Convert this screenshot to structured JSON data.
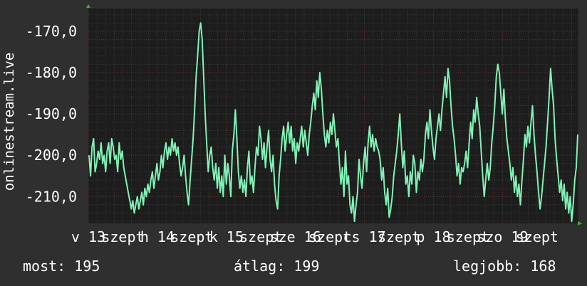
{
  "chart_data": {
    "type": "line",
    "ylabel": "onlinestream.live",
    "ylim": [
      -216.5,
      -164.5
    ],
    "y_ticks": [
      "-170,0",
      "-180,0",
      "-190,0",
      "-200,0",
      "-210,0"
    ],
    "y_tick_values": [
      -170,
      -180,
      -190,
      -200,
      -210
    ],
    "x_ticks": [
      "v 13",
      "szept",
      "h 14",
      "szept",
      "k 15",
      "szept",
      "sze 16",
      "szept",
      "cs 17",
      "szept",
      "p 18",
      "szept",
      "szo 19",
      "szept"
    ],
    "x_tick_positions": [
      0,
      0.5,
      1,
      1.5,
      2,
      2.5,
      3,
      3.5,
      4,
      4.5,
      5,
      5.5,
      6,
      6.5
    ],
    "xlim": [
      0,
      7.1
    ],
    "series": [
      {
        "color": "#7ff3b5",
        "values": [
          -200,
          -205,
          -198,
          -196,
          -204,
          -202,
          -199,
          -201,
          -197,
          -202,
          -200,
          -204,
          -199,
          -197,
          -202,
          -196,
          -198,
          -201,
          -200,
          -204,
          -197,
          -201,
          -199,
          -203,
          -205,
          -207,
          -209,
          -211,
          -213,
          -211,
          -214,
          -212,
          -210,
          -213,
          -211,
          -209,
          -212,
          -208,
          -210,
          -207,
          -209,
          -206,
          -204,
          -208,
          -205,
          -202,
          -206,
          -204,
          -200,
          -203,
          -199,
          -197,
          -201,
          -198,
          -200,
          -196,
          -199,
          -197,
          -200,
          -198,
          -202,
          -205,
          -203,
          -200,
          -205,
          -209,
          -212,
          -206,
          -201,
          -196,
          -189,
          -181,
          -176,
          -170,
          -168,
          -172,
          -181,
          -190,
          -197,
          -204,
          -200,
          -198,
          -203,
          -206,
          -202,
          -208,
          -203,
          -209,
          -205,
          -210,
          -200,
          -207,
          -202,
          -205,
          -210,
          -199,
          -195,
          -189,
          -196,
          -204,
          -208,
          -205,
          -209,
          -206,
          -210,
          -203,
          -199,
          -207,
          -205,
          -209,
          -203,
          -198,
          -200,
          -193,
          -196,
          -201,
          -197,
          -203,
          -198,
          -194,
          -201,
          -204,
          -200,
          -207,
          -211,
          -213,
          -205,
          -201,
          -196,
          -193,
          -199,
          -195,
          -192,
          -197,
          -193,
          -199,
          -196,
          -202,
          -197,
          -199,
          -196,
          -193,
          -198,
          -194,
          -197,
          -200,
          -195,
          -192,
          -188,
          -185,
          -189,
          -182,
          -186,
          -180,
          -184,
          -190,
          -195,
          -198,
          -194,
          -197,
          -192,
          -195,
          -190,
          -194,
          -198,
          -196,
          -202,
          -207,
          -203,
          -210,
          -199,
          -207,
          -205,
          -212,
          -214,
          -210,
          -216,
          -212,
          -209,
          -201,
          -205,
          -208,
          -202,
          -198,
          -204,
          -197,
          -193,
          -198,
          -195,
          -199,
          -196,
          -198,
          -199,
          -201,
          -206,
          -203,
          -209,
          -212,
          -208,
          -215,
          -213,
          -210,
          -205,
          -202,
          -199,
          -195,
          -190,
          -197,
          -203,
          -199,
          -207,
          -205,
          -210,
          -204,
          -207,
          -200,
          -202,
          -209,
          -204,
          -206,
          -201,
          -204,
          -201,
          -195,
          -192,
          -196,
          -189,
          -194,
          -198,
          -201,
          -196,
          -193,
          -190,
          -194,
          -189,
          -185,
          -181,
          -186,
          -179,
          -182,
          -188,
          -193,
          -196,
          -200,
          -205,
          -202,
          -207,
          -203,
          -204,
          -202,
          -199,
          -203,
          -197,
          -192,
          -196,
          -189,
          -192,
          -186,
          -190,
          -193,
          -199,
          -205,
          -210,
          -206,
          -202,
          -206,
          -203,
          -197,
          -193,
          -188,
          -181,
          -178,
          -180,
          -185,
          -190,
          -184,
          -191,
          -196,
          -199,
          -202,
          -206,
          -203,
          -209,
          -205,
          -210,
          -207,
          -212,
          -206,
          -201,
          -195,
          -198,
          -193,
          -197,
          -192,
          -188,
          -195,
          -200,
          -204,
          -209,
          -213,
          -210,
          -206,
          -202,
          -198,
          -192,
          -186,
          -179,
          -184,
          -188,
          -196,
          -201,
          -205,
          -209,
          -206,
          -211,
          -207,
          -213,
          -209,
          -214,
          -210,
          -216,
          -212,
          -206,
          -203,
          -195
        ]
      }
    ]
  },
  "stats": {
    "most": "most: 195",
    "atlag": "átlag: 199",
    "legjobb": "legjobb: 168"
  },
  "colors": {
    "background": "#2f2f2f",
    "plot_area": "#1d1d1d",
    "line": "#7ff3b5",
    "grid_minor": "#3a3a3a",
    "grid_major": "#5a3333",
    "axis_arrow": "#20c020"
  }
}
